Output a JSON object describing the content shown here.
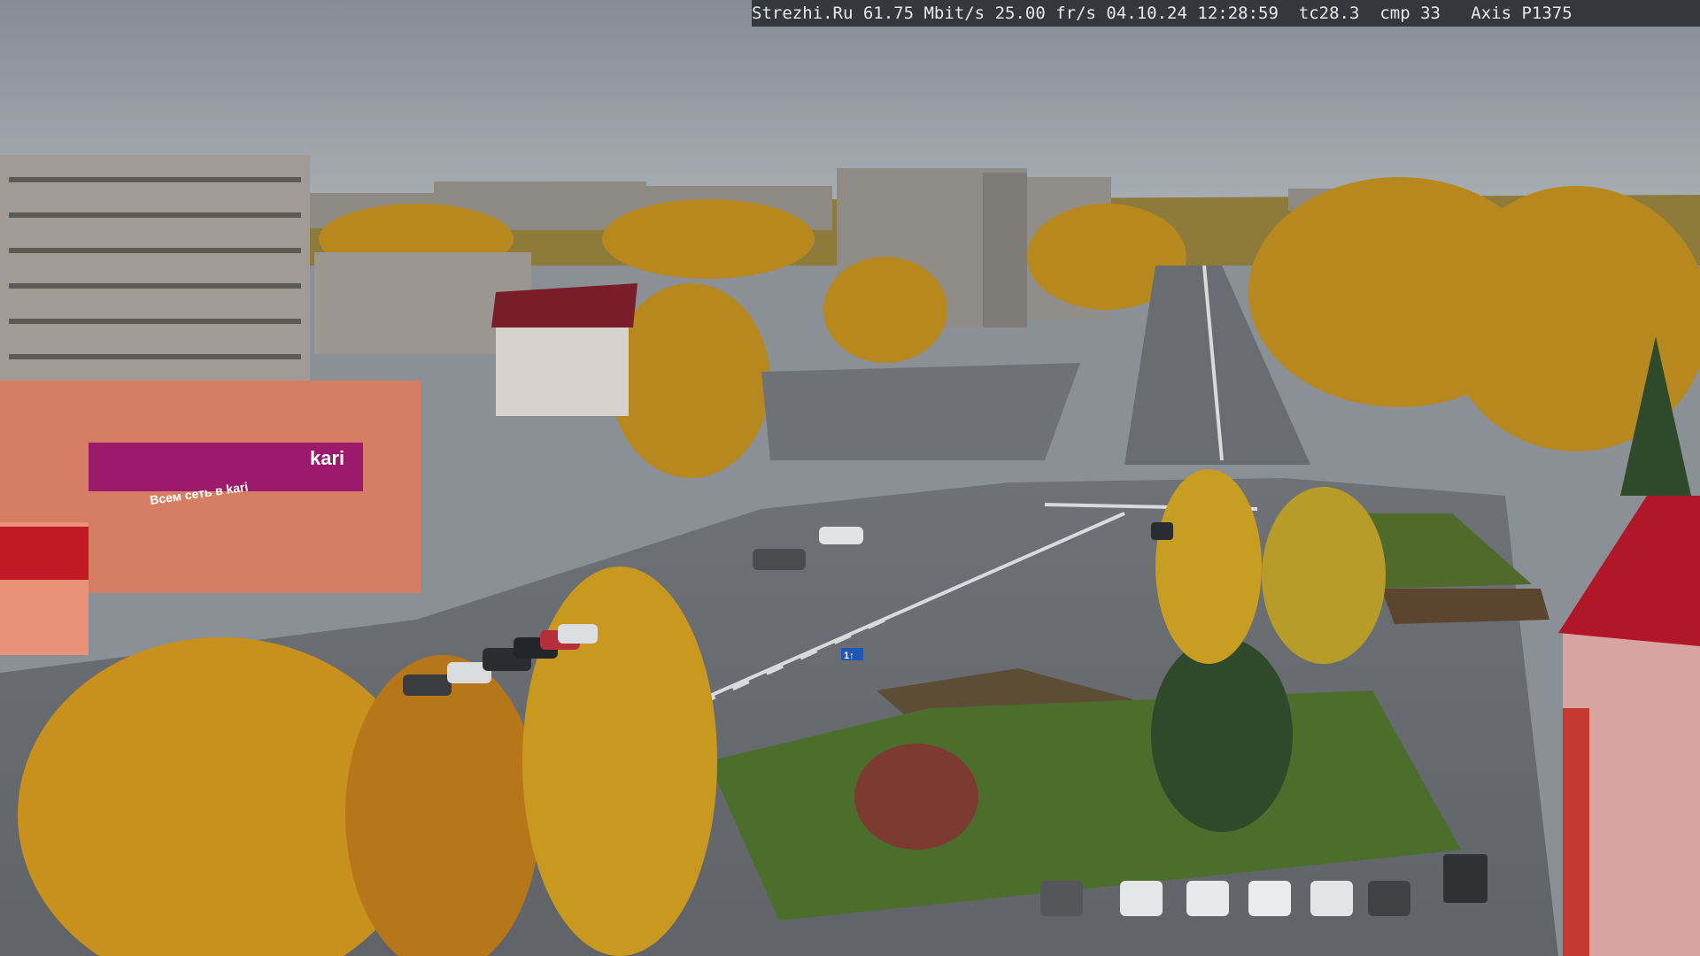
{
  "overlay": {
    "site": "Strezhi.Ru",
    "bitrate": "61.75 Mbit/s",
    "framerate": "25.00 fr/s",
    "date": "04.10.24",
    "time": "12:28:59",
    "tc": "tc28.3",
    "cmp": "cmp 33",
    "camera": "Axis P1375"
  },
  "signs": {
    "store_logo": "kari",
    "store_tagline": "Всем сеть в kari",
    "street_sign": "1↑"
  },
  "colors": {
    "sky": "#9aa3ab",
    "asphalt": "#6b6e72",
    "autumn_tree": "#c99a1f",
    "grass": "#4c6e2c",
    "store_magenta": "#9b1a6b",
    "roof_red": "#b0182a"
  }
}
